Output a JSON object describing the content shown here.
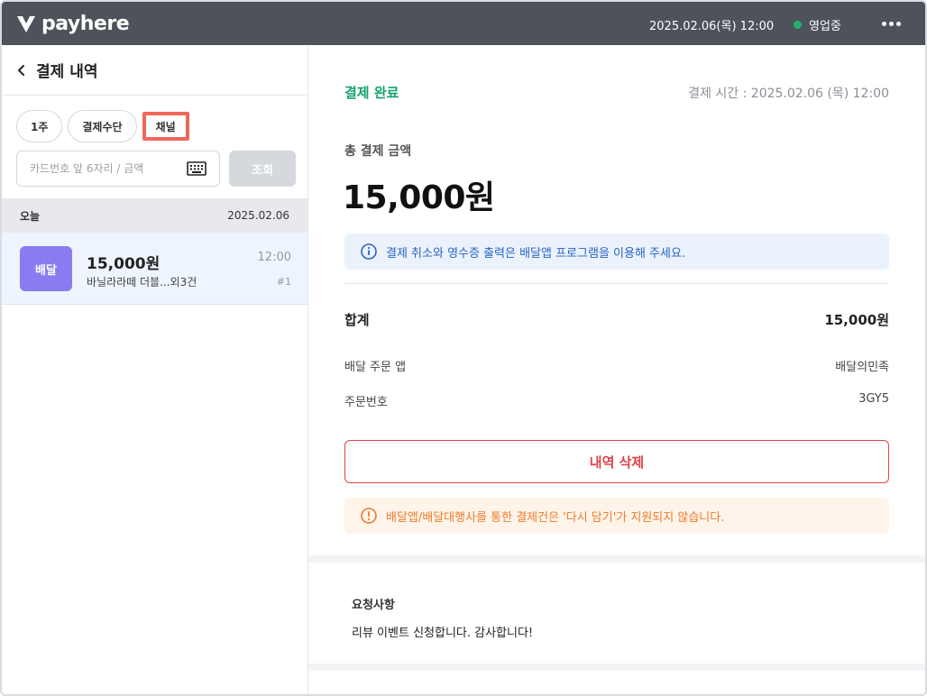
{
  "topbar": {
    "brand": "payhere",
    "datetime": "2025.02.06(목) 12:00",
    "status": "영업중",
    "status_color": "#1fb46a",
    "bg_color": "#4d525b"
  },
  "left": {
    "title": "결제 내역",
    "filters": [
      {
        "label": "1주"
      },
      {
        "label": "결제수단"
      },
      {
        "label": "채널"
      }
    ],
    "search": {
      "placeholder": "카드번호 앞 6자리 / 금액",
      "button_label": "조회"
    },
    "date_group": {
      "label": "오늘",
      "date": "2025.02.06"
    },
    "transactions": [
      {
        "badge": "배달",
        "badge_color": "#8a7cf0",
        "amount": "15,000원",
        "description": "바닐라라떼 더블...외3건",
        "time": "12:00",
        "number": "#1"
      }
    ]
  },
  "detail": {
    "status": "결제 완료",
    "status_color": "#12a36b",
    "payment_time": "결제 시간 : 2025.02.06 (목) 12:00",
    "total_label": "총 결제 금액",
    "total_amount": "15,000원",
    "info_notice": "결제 취소와 영수증 출력은 배달앱 프로그램을 이용해 주세요.",
    "sum_label": "합계",
    "sum_value": "15,000원",
    "rows": [
      {
        "label": "배달 주문 앱",
        "value": "배달의민족"
      },
      {
        "label": "주문번호",
        "value": "3GY5"
      }
    ],
    "delete_label": "내역 삭제",
    "delete_color": "#e0424b",
    "warning_notice": "배달앱/배달대행사를 통한 결제건은 '다시 담기'가 지원되지 않습니다.",
    "request_title": "요청사항",
    "request_text": "리뷰 이벤트 신청합니다. 감사합니다!"
  }
}
